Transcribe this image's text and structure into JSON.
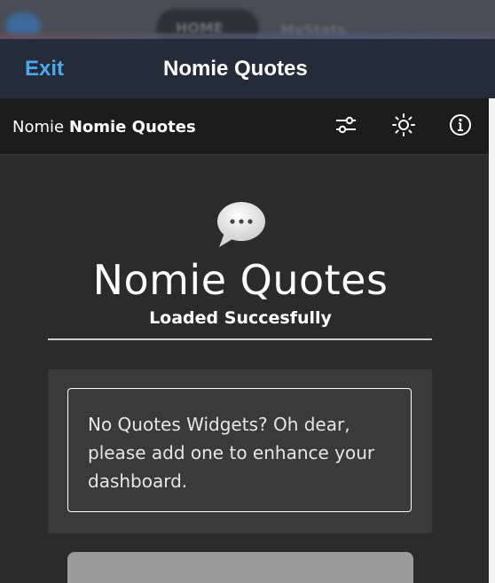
{
  "nav": {
    "exit_label": "Exit",
    "title": "Nomie Quotes"
  },
  "background": {
    "tab_left": "HOME",
    "tab_right": "MyStats"
  },
  "subheader": {
    "prefix": "Nomie",
    "title": "Nomie Quotes",
    "icons": [
      "sliders-icon",
      "sun-icon",
      "info-icon"
    ]
  },
  "main": {
    "icon": "speech-bubble-icon",
    "title": "Nomie Quotes",
    "status": "Loaded Succesfully",
    "message": "No Quotes Widgets? Oh dear, please add one to enhance your dashboard."
  },
  "colors": {
    "accent": "#4aa8ee",
    "nav_bg": "#242b39",
    "subheader_bg": "#1c1c1c",
    "page_bg": "#2b2b2b",
    "panel_bg": "#3a3a3a"
  }
}
